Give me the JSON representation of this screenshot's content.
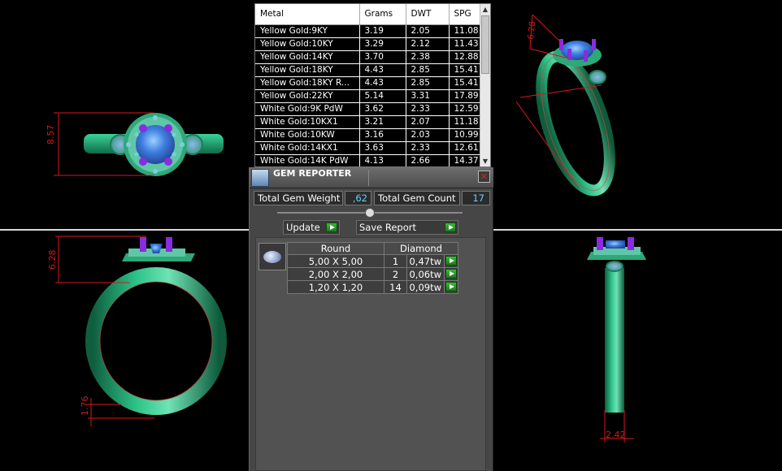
{
  "metal_table": {
    "headers": [
      "Metal",
      "Grams",
      "DWT",
      "SPG"
    ],
    "rows": [
      [
        "Yellow Gold:9KY",
        "3.19",
        "2.05",
        "11.08"
      ],
      [
        "Yellow Gold:10KY",
        "3.29",
        "2.12",
        "11.43"
      ],
      [
        "Yellow Gold:14KY",
        "3.70",
        "2.38",
        "12.88"
      ],
      [
        "Yellow Gold:18KY",
        "4.43",
        "2.85",
        "15.41"
      ],
      [
        "Yellow Gold:18KY R...",
        "4.43",
        "2.85",
        "15.41"
      ],
      [
        "Yellow Gold:22KY",
        "5.14",
        "3.31",
        "17.89"
      ],
      [
        "White Gold:9K PdW",
        "3.62",
        "2.33",
        "12.59"
      ],
      [
        "White Gold:10KX1",
        "3.21",
        "2.07",
        "11.18"
      ],
      [
        "White Gold:10KW",
        "3.16",
        "2.03",
        "10.99"
      ],
      [
        "White Gold:14KX1",
        "3.63",
        "2.33",
        "12.61"
      ],
      [
        "White Gold:14K PdW",
        "4.13",
        "2.66",
        "14.37"
      ]
    ]
  },
  "gem_reporter": {
    "title": "GEM REPORTER",
    "close_icon": "close-icon",
    "total_gem_weight_label": "Total Gem Weight",
    "total_gem_weight_value": ",62",
    "total_gem_count_label": "Total Gem Count",
    "total_gem_count_value": "17",
    "update_label": "Update",
    "save_report_label": "Save Report",
    "gem_headers": [
      "Round",
      "Diamond"
    ],
    "gems": [
      {
        "size": "5,00 X 5,00",
        "count": "1",
        "weight": "0,47tw"
      },
      {
        "size": "2,00 X 2,00",
        "count": "2",
        "weight": "0,06tw"
      },
      {
        "size": "1,20 X 1,20",
        "count": "14",
        "weight": "0,09tw"
      }
    ]
  },
  "dimensions": {
    "top_left_height": "8.57",
    "bottom_left_height": "6.28",
    "bottom_left_shank": "1.76",
    "bottom_right_width": "2.42",
    "top_right_height": "6.28"
  },
  "colors": {
    "ring_metal": "#1a9e6a",
    "center_stone": "#4a86e0",
    "prongs": "#8a2be2",
    "dimension_lines": "#d81818",
    "value_text": "#5fd3ff"
  }
}
